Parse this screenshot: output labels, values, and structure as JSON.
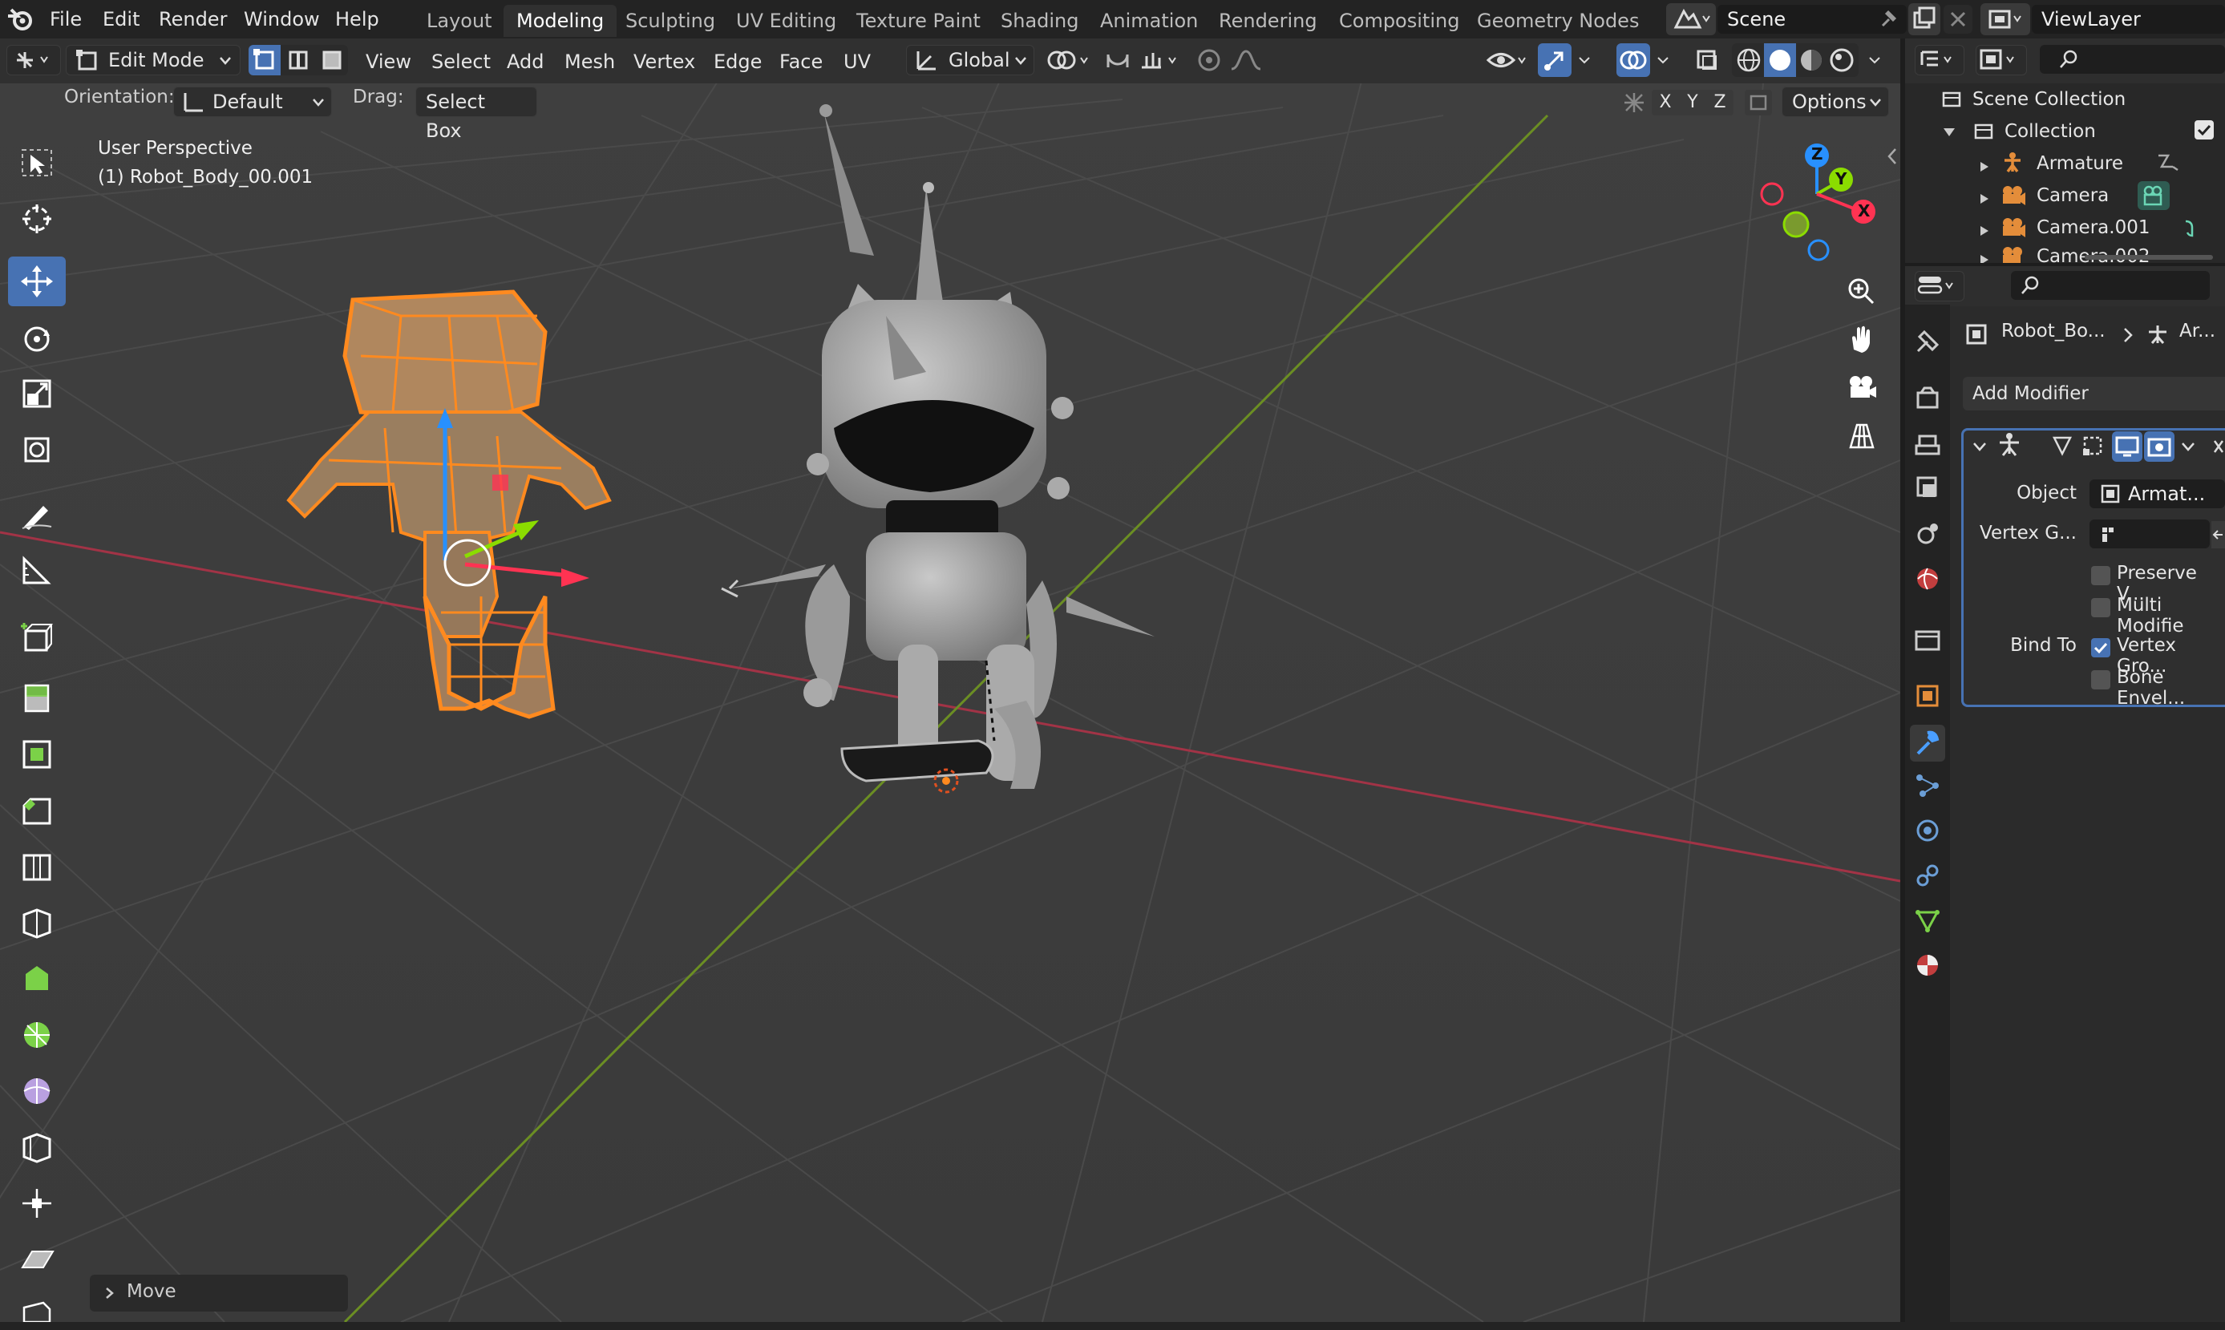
{
  "top_menu": [
    "File",
    "Edit",
    "Render",
    "Window",
    "Help"
  ],
  "workspaces": [
    {
      "label": "Layout",
      "active": false
    },
    {
      "label": "Modeling",
      "active": true
    },
    {
      "label": "Sculpting",
      "active": false
    },
    {
      "label": "UV Editing",
      "active": false
    },
    {
      "label": "Texture Paint",
      "active": false
    },
    {
      "label": "Shading",
      "active": false
    },
    {
      "label": "Animation",
      "active": false
    },
    {
      "label": "Rendering",
      "active": false
    },
    {
      "label": "Compositing",
      "active": false
    },
    {
      "label": "Geometry Nodes",
      "active": false
    }
  ],
  "scene_name": "Scene",
  "view_layer": "ViewLayer",
  "header": {
    "mode": "Edit Mode",
    "menus": [
      "View",
      "Select",
      "Add",
      "Mesh",
      "Vertex",
      "Edge",
      "Face",
      "UV"
    ],
    "transform_orientation": "Global",
    "axis_x": "X",
    "axis_y": "Y",
    "axis_z": "Z",
    "options": "Options"
  },
  "tool_settings": {
    "orientation_label": "Orientation:",
    "orientation_value": "Default",
    "drag_label": "Drag:",
    "drag_value": "Select Box"
  },
  "viewport": {
    "perspective": "User Perspective",
    "object_info": "(1) Robot_Body_00.001",
    "last_operator": "Move",
    "gizmo": {
      "x": "X",
      "y": "Y",
      "z": "Z"
    }
  },
  "outliner": {
    "root": "Scene Collection",
    "collection": "Collection",
    "items": [
      "Armature",
      "Camera",
      "Camera.001",
      "Camera.002"
    ]
  },
  "properties": {
    "breadcrumb_object": "Robot_Bo...",
    "breadcrumb_modifier": "Ar...",
    "add_modifier": "Add Modifier",
    "object_label": "Object",
    "object_value": "Armat...",
    "vertex_group_label": "Vertex G...",
    "preserve_volume": "Preserve V...",
    "multi_modifier": "Multi Modifie",
    "bind_to_label": "Bind To",
    "vertex_groups": "Vertex Gro...",
    "bone_envelopes": "Bone Envel..."
  },
  "colors": {
    "accent": "#4772b3",
    "selection": "#ff8a1f",
    "axis_x": "#ff3352",
    "axis_y": "#8bdc00",
    "axis_z": "#2890ff"
  }
}
